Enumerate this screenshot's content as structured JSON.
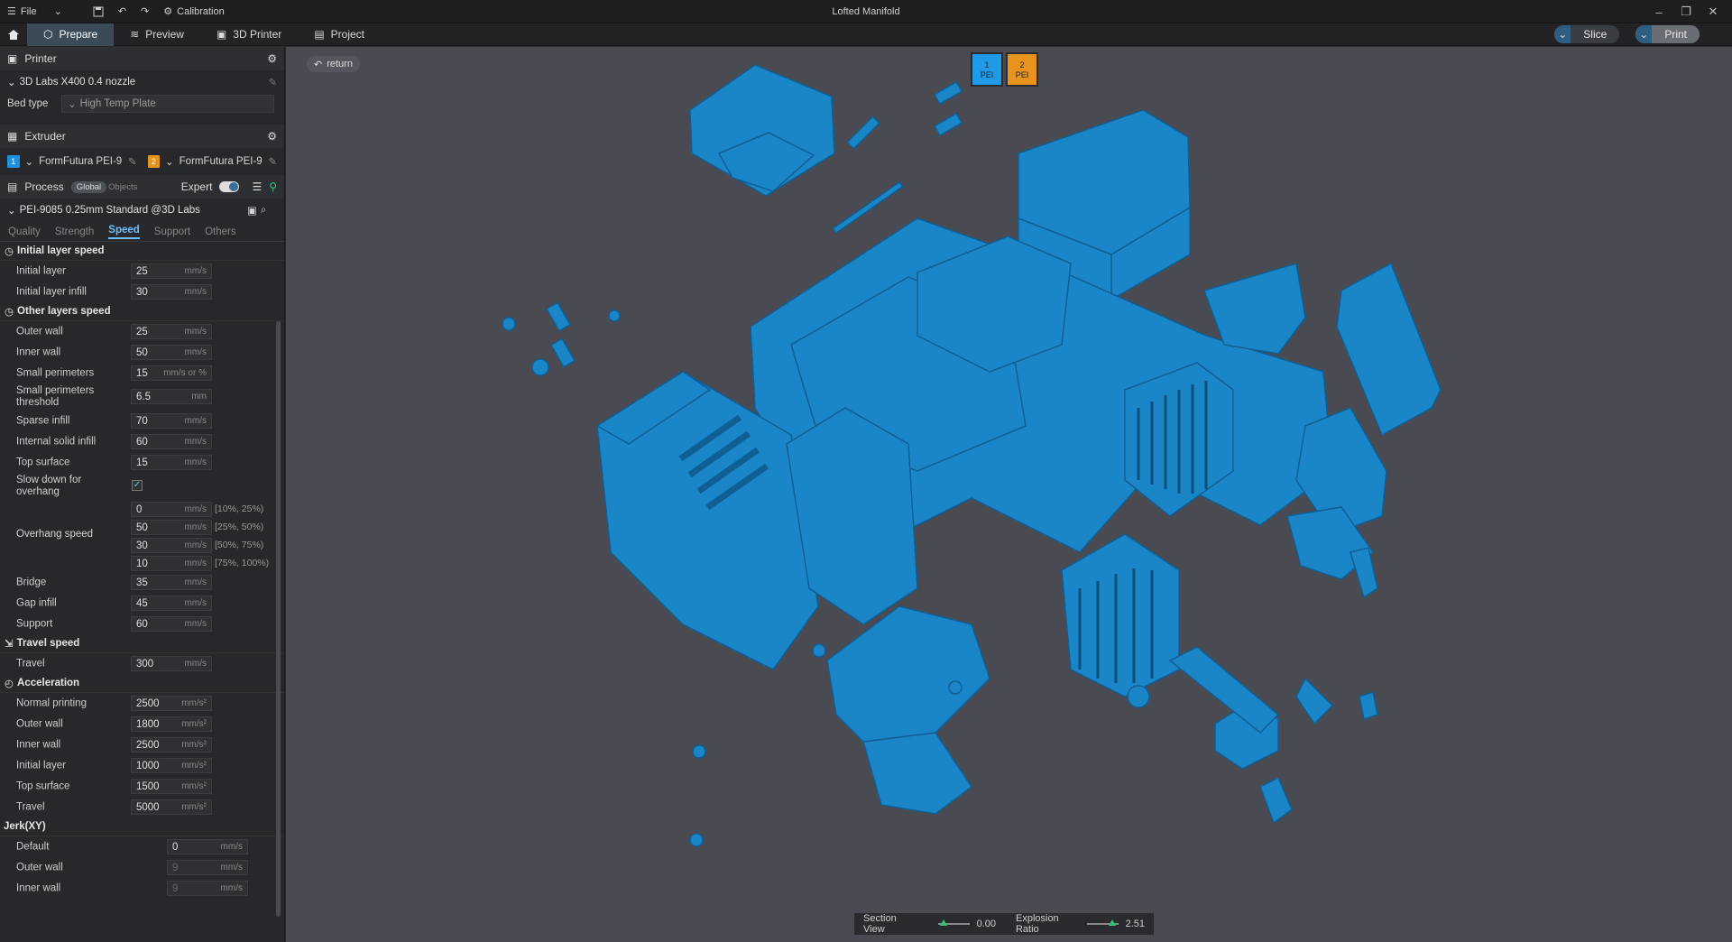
{
  "titlebar": {
    "file_label": "File",
    "calibration_label": "Calibration",
    "window_title": "Lofted Manifold"
  },
  "nav": {
    "tabs": [
      {
        "label": "Prepare"
      },
      {
        "label": "Preview"
      },
      {
        "label": "3D Printer"
      },
      {
        "label": "Project"
      }
    ],
    "slice_label": "Slice",
    "print_label": "Print"
  },
  "printer": {
    "title": "Printer",
    "preset": "3D Labs X400 0.4 nozzle",
    "bed_label": "Bed type",
    "bed_value": "High Temp Plate"
  },
  "extruder": {
    "title": "Extruder",
    "filaments": [
      {
        "index": "1",
        "name": "FormFutura PEI-9...",
        "color": "#1f8fe0"
      },
      {
        "index": "2",
        "name": "FormFutura PEI-9...",
        "color": "#e8931e"
      }
    ]
  },
  "process": {
    "title": "Process",
    "global_label": "Global",
    "objects_label": "Objects",
    "expert_label": "Expert",
    "preset": "PEI-9085 0.25mm Standard @3D Labs"
  },
  "subtabs": [
    "Quality",
    "Strength",
    "Speed",
    "Support",
    "Others"
  ],
  "groups": {
    "initial": {
      "title": "Initial layer speed",
      "rows": [
        {
          "name": "Initial layer",
          "value": "25",
          "unit": "mm/s"
        },
        {
          "name": "Initial layer infill",
          "value": "30",
          "unit": "mm/s"
        }
      ]
    },
    "other": {
      "title": "Other layers speed",
      "rows": [
        {
          "name": "Outer wall",
          "value": "25",
          "unit": "mm/s"
        },
        {
          "name": "Inner wall",
          "value": "50",
          "unit": "mm/s"
        },
        {
          "name": "Small perimeters",
          "value": "15",
          "unit": "mm/s or %"
        },
        {
          "name": "Small perimeters threshold",
          "value": "6.5",
          "unit": "mm"
        },
        {
          "name": "Sparse infill",
          "value": "70",
          "unit": "mm/s"
        },
        {
          "name": "Internal solid infill",
          "value": "60",
          "unit": "mm/s"
        },
        {
          "name": "Top surface",
          "value": "15",
          "unit": "mm/s"
        }
      ],
      "slowdown_label": "Slow down for overhang",
      "overhang_label": "Overhang speed",
      "overhang": [
        {
          "value": "0",
          "unit": "mm/s",
          "range": "[10%, 25%)"
        },
        {
          "value": "50",
          "unit": "mm/s",
          "range": "[25%, 50%)"
        },
        {
          "value": "30",
          "unit": "mm/s",
          "range": "[50%, 75%)"
        },
        {
          "value": "10",
          "unit": "mm/s",
          "range": "[75%, 100%)"
        }
      ],
      "rows2": [
        {
          "name": "Bridge",
          "value": "35",
          "unit": "mm/s"
        },
        {
          "name": "Gap infill",
          "value": "45",
          "unit": "mm/s"
        },
        {
          "name": "Support",
          "value": "60",
          "unit": "mm/s"
        }
      ]
    },
    "travel": {
      "title": "Travel speed",
      "rows": [
        {
          "name": "Travel",
          "value": "300",
          "unit": "mm/s"
        }
      ]
    },
    "accel": {
      "title": "Acceleration",
      "rows": [
        {
          "name": "Normal printing",
          "value": "2500",
          "unit": "mm/s²"
        },
        {
          "name": "Outer wall",
          "value": "1800",
          "unit": "mm/s²"
        },
        {
          "name": "Inner wall",
          "value": "2500",
          "unit": "mm/s²"
        },
        {
          "name": "Initial layer",
          "value": "1000",
          "unit": "mm/s²"
        },
        {
          "name": "Top surface",
          "value": "1500",
          "unit": "mm/s²"
        },
        {
          "name": "Travel",
          "value": "5000",
          "unit": "mm/s²"
        }
      ]
    },
    "jerk": {
      "title": "Jerk(XY)",
      "rows": [
        {
          "name": "Default",
          "value": "0",
          "unit": "mm/s"
        },
        {
          "name": "Outer wall",
          "value": "9",
          "unit": "mm/s"
        },
        {
          "name": "Inner wall",
          "value": "9",
          "unit": "mm/s"
        }
      ]
    }
  },
  "viewport": {
    "return_label": "return",
    "plate_filaments": [
      {
        "index": "1",
        "label": "PEI",
        "color": "#1f9ae6"
      },
      {
        "index": "2",
        "label": "PEI",
        "color": "#e8931e"
      }
    ],
    "model_color": "#1a86c8"
  },
  "bottombar": {
    "section_label": "Section View",
    "section_value": "0.00",
    "explosion_label": "Explosion Ratio",
    "explosion_value": "2.51"
  }
}
